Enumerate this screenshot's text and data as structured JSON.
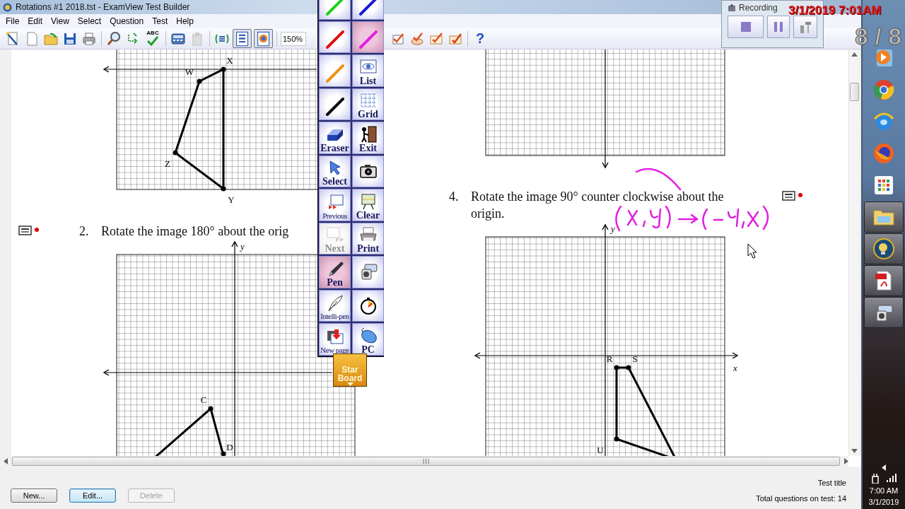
{
  "window": {
    "title": "Rotations #1 2018.tst - ExamView Test Builder"
  },
  "menu": [
    {
      "label": "File"
    },
    {
      "label": "Edit"
    },
    {
      "label": "View"
    },
    {
      "label": "Select"
    },
    {
      "label": "Question"
    },
    {
      "label": "Test"
    },
    {
      "label": "Help"
    }
  ],
  "toolbar": {
    "spellcheck_text": "ABC",
    "question_view_on": true,
    "graphic_view_on": true,
    "zoom": "150%",
    "help_text": "?"
  },
  "questions": [
    {
      "number": "2.",
      "text": "Rotate the image 180° about the orig"
    },
    {
      "number": "4.",
      "text": "Rotate the image 90° counter clockwise about the origin."
    }
  ],
  "graphs": [
    {
      "kind": "top_left",
      "labels": [
        "W",
        "X",
        "Y",
        "Z"
      ]
    },
    {
      "kind": "bottom_left",
      "labels": [
        "y",
        "C",
        "D"
      ]
    },
    {
      "kind": "bottom_right",
      "labels": [
        "y",
        "x",
        "R",
        "S",
        "U"
      ]
    }
  ],
  "palette": {
    "buttons": [
      {
        "kind": "pen",
        "color": "#1fd01f",
        "selected": false
      },
      {
        "kind": "pen",
        "color": "#1818d8",
        "selected": false
      },
      {
        "kind": "pen",
        "color": "#e01010",
        "selected": false
      },
      {
        "kind": "pen",
        "color": "#e020e0",
        "selected": true
      },
      {
        "kind": "pen",
        "color": "#f09018",
        "selected": false
      },
      {
        "kind": "tool",
        "label": "List",
        "selected": false,
        "disabled": false
      },
      {
        "kind": "pen",
        "color": "#000000",
        "selected": false
      },
      {
        "kind": "tool",
        "label": "Grid",
        "selected": false,
        "disabled": false
      },
      {
        "kind": "tool",
        "label": "Eraser",
        "selected": false,
        "disabled": false
      },
      {
        "kind": "tool",
        "label": "Exit",
        "selected": false,
        "disabled": false
      },
      {
        "kind": "tool",
        "label": "Select",
        "selected": false,
        "disabled": false
      },
      {
        "kind": "tool",
        "selected": false,
        "disabled": false
      },
      {
        "kind": "tool",
        "label": "Previous",
        "selected": false,
        "disabled": false
      },
      {
        "kind": "tool",
        "label": "Clear",
        "selected": false,
        "disabled": false
      },
      {
        "kind": "tool",
        "label": "Next",
        "selected": false,
        "disabled": true
      },
      {
        "kind": "tool",
        "label": "Print",
        "selected": false,
        "disabled": false
      },
      {
        "kind": "tool",
        "label": "Pen",
        "selected": true,
        "disabled": false
      },
      {
        "kind": "tool",
        "selected": false,
        "disabled": false
      },
      {
        "kind": "tool",
        "label": "Intelli-pen",
        "selected": false,
        "disabled": false
      },
      {
        "kind": "tool",
        "selected": false,
        "disabled": false
      },
      {
        "kind": "tool",
        "label": "New page",
        "selected": false,
        "disabled": false
      },
      {
        "kind": "tool",
        "label": "PC",
        "selected": false,
        "disabled": false
      }
    ],
    "star_board": "Star Board"
  },
  "recorder": {
    "title": "Recording"
  },
  "overlay": {
    "timestamp": "3/1/2019 7:01AM",
    "counter": "8 / 8"
  },
  "footer": {
    "buttons": [
      {
        "label": "New...",
        "focused": false,
        "disabled": false
      },
      {
        "label": "Edit...",
        "focused": true,
        "disabled": false
      },
      {
        "label": "Delete",
        "focused": false,
        "disabled": true
      }
    ],
    "test_title": "Test title",
    "total": "Total questions on test: 14"
  },
  "taskbar": {
    "time": "7:00 AM",
    "date": "3/1/2019"
  }
}
